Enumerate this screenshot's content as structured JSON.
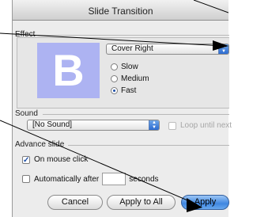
{
  "window": {
    "title": "Slide Transition"
  },
  "effect": {
    "section_label": "Effect",
    "preview_letter": "B",
    "transition_value": "Cover Right",
    "speed_options": [
      "Slow",
      "Medium",
      "Fast"
    ],
    "speed_selected": "Fast"
  },
  "sound": {
    "section_label": "Sound",
    "value": "[No Sound]",
    "loop_label": "Loop until next",
    "loop_checked": false
  },
  "advance": {
    "section_label": "Advance slide",
    "on_mouse_click_label": "On mouse click",
    "on_mouse_click_checked": true,
    "automatically_after_label": "Automatically after",
    "automatically_after_checked": false,
    "seconds_value": "",
    "seconds_label": "seconds"
  },
  "buttons": {
    "cancel": "Cancel",
    "apply_to_all": "Apply to All",
    "apply": "Apply"
  },
  "colors": {
    "preview_bg": "#adb3f2",
    "default_button": "#3f86e0"
  }
}
